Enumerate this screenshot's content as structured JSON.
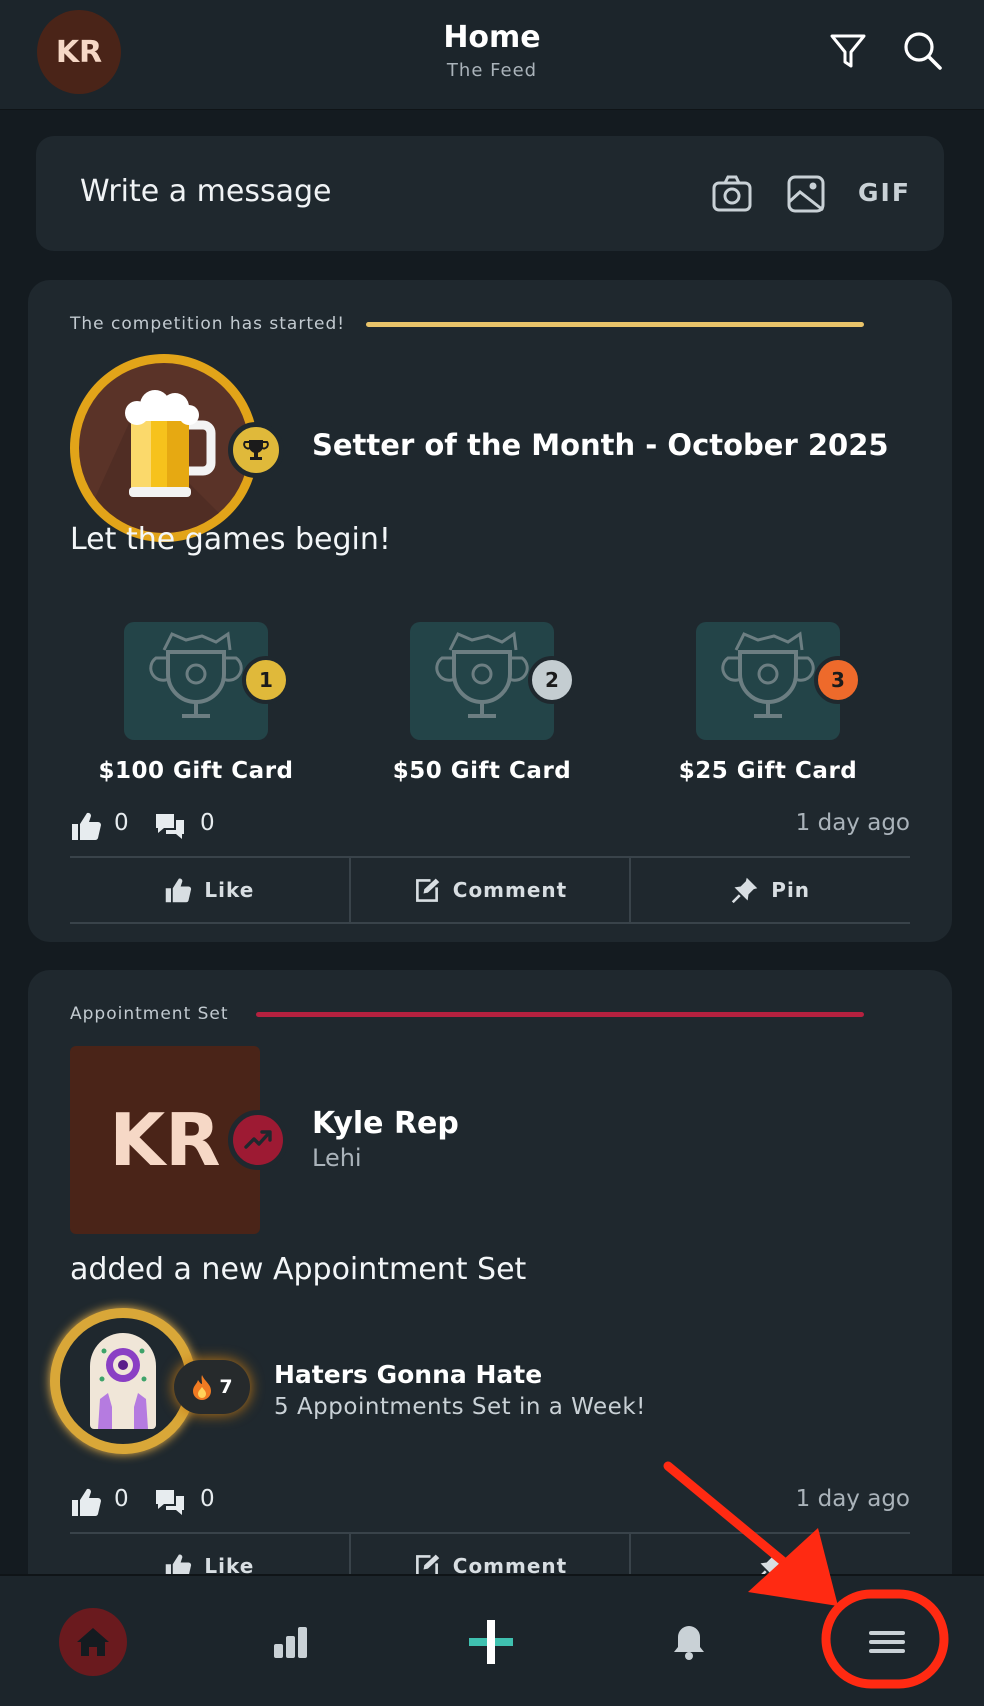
{
  "header": {
    "avatar_initials": "KR",
    "title": "Home",
    "subtitle": "The Feed",
    "filter_icon": "filter-icon",
    "search_icon": "search-icon"
  },
  "composer": {
    "placeholder": "Write a message",
    "camera_icon": "camera-icon",
    "image_icon": "image-icon",
    "gif_label": "GIF"
  },
  "competition_post": {
    "section_label": "The competition has started!",
    "section_color": "#e9c46a",
    "title": "Setter of the Month - October 2025",
    "message": "Let the games begin!",
    "prizes": [
      {
        "rank": "1",
        "label": "$100 Gift Card",
        "rank_color": "#e0b93a"
      },
      {
        "rank": "2",
        "label": "$50 Gift Card",
        "rank_color": "#c4cdd1"
      },
      {
        "rank": "3",
        "label": "$25 Gift Card",
        "rank_color": "#ee6a2b"
      }
    ],
    "likes": "0",
    "comments": "0",
    "time_ago": "1 day ago",
    "actions": {
      "like": "Like",
      "comment": "Comment",
      "pin": "Pin"
    }
  },
  "appointment_post": {
    "section_label": "Appointment Set",
    "section_color": "#b5213f",
    "user_initials": "KR",
    "user_name": "Kyle Rep",
    "user_location": "Lehi",
    "message": "added a new Appointment Set",
    "achievement": {
      "streak": "7",
      "title": "Haters Gonna Hate",
      "description": "5 Appointments Set in a Week!"
    },
    "likes": "0",
    "comments": "0",
    "time_ago": "1 day ago",
    "actions": {
      "like": "Like",
      "comment": "Comment"
    }
  },
  "bottom_nav": {
    "items": [
      "home-icon",
      "leaderboard-icon",
      "add-icon",
      "bell-icon",
      "menu-icon"
    ],
    "accent_color": "#3fc1b0",
    "annotation_color": "#ff2a12"
  }
}
